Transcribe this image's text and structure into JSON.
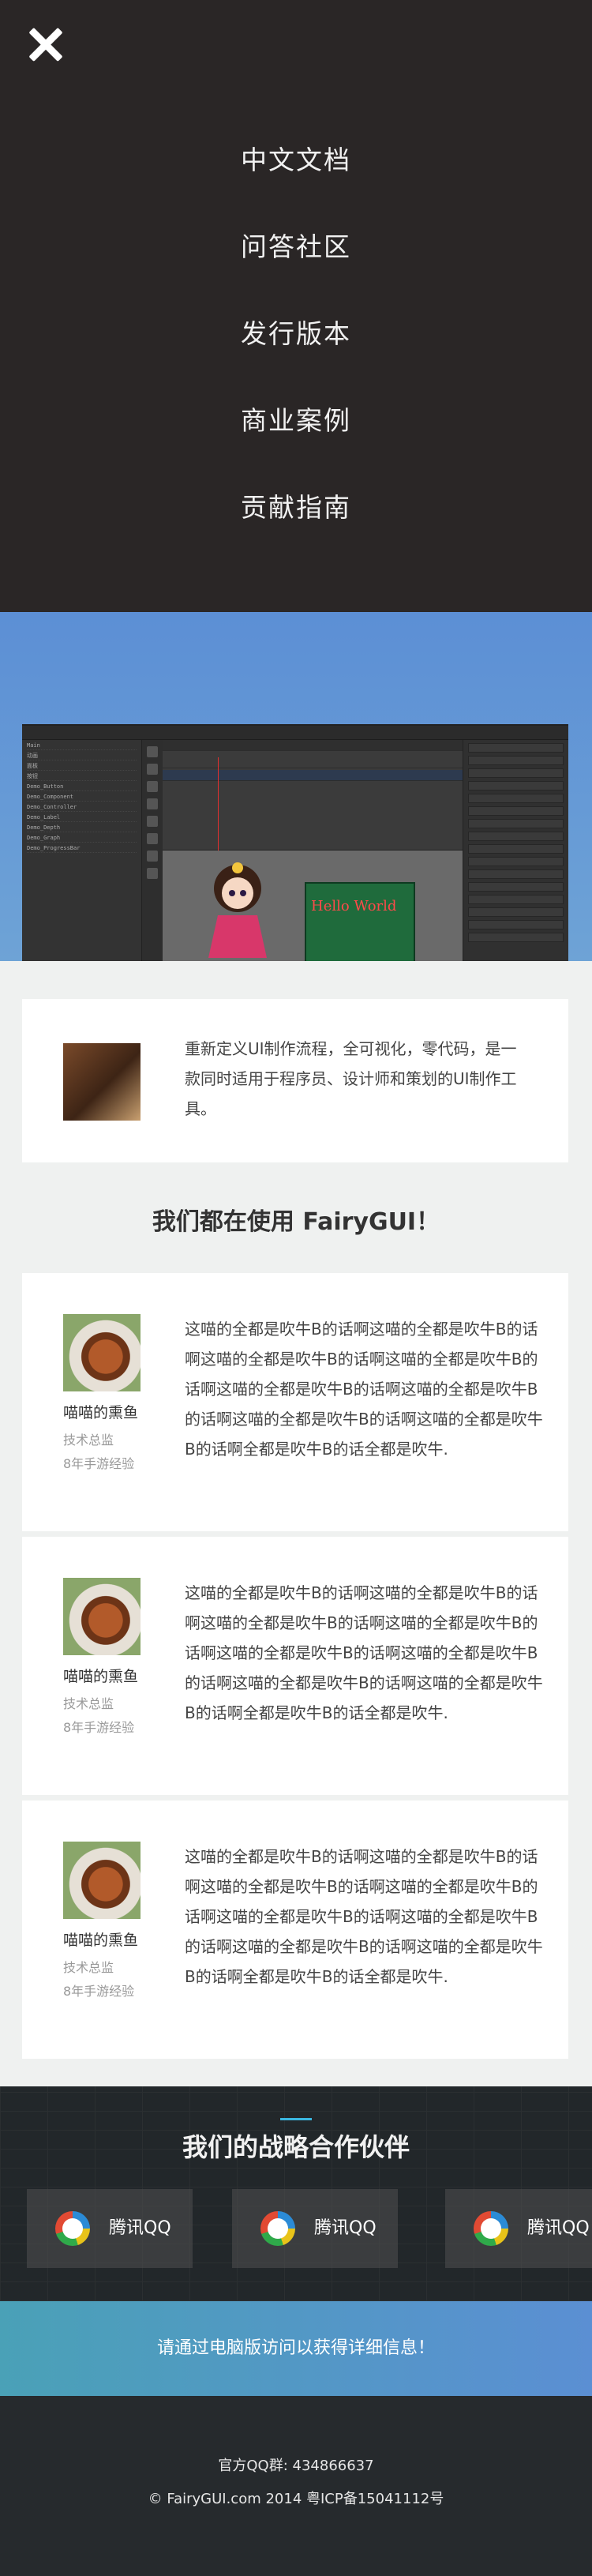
{
  "menu": {
    "items": [
      "中文文档",
      "问答社区",
      "发行版本",
      "商业案例",
      "贡献指南"
    ]
  },
  "editor_preview": {
    "stage_text": "Hello World",
    "tree_items": [
      "Main",
      "动画",
      "面板",
      "按钮",
      "Demo_Button",
      "Demo_Component",
      "Demo_Controller",
      "Demo_Label",
      "Demo_Depth",
      "Demo_Graph",
      "Demo_ProgressBar"
    ]
  },
  "intro": {
    "text": "重新定义UI制作流程，全可视化，零代码，是一款同时适用于程序员、设计师和策划的UI制作工具。"
  },
  "users_section": {
    "title": "我们都在使用 FairyGUI！"
  },
  "testimonials": [
    {
      "name": "喵喵的熏鱼",
      "role": "技术总监",
      "exp": "8年手游经验",
      "text": "这喵的全都是吹牛B的话啊这喵的全都是吹牛B的话啊这喵的全都是吹牛B的话啊这喵的全都是吹牛B的话啊这喵的全都是吹牛B的话啊这喵的全都是吹牛B的话啊这喵的全都是吹牛B的话啊这喵的全都是吹牛B的话啊全都是吹牛B的话全都是吹牛."
    },
    {
      "name": "喵喵的熏鱼",
      "role": "技术总监",
      "exp": "8年手游经验",
      "text": "这喵的全都是吹牛B的话啊这喵的全都是吹牛B的话啊这喵的全都是吹牛B的话啊这喵的全都是吹牛B的话啊这喵的全都是吹牛B的话啊这喵的全都是吹牛B的话啊这喵的全都是吹牛B的话啊这喵的全都是吹牛B的话啊全都是吹牛B的话全都是吹牛."
    },
    {
      "name": "喵喵的熏鱼",
      "role": "技术总监",
      "exp": "8年手游经验",
      "text": "这喵的全都是吹牛B的话啊这喵的全都是吹牛B的话啊这喵的全都是吹牛B的话啊这喵的全都是吹牛B的话啊这喵的全都是吹牛B的话啊这喵的全都是吹牛B的话啊这喵的全都是吹牛B的话啊这喵的全都是吹牛B的话啊全都是吹牛B的话全都是吹牛."
    }
  ],
  "partners": {
    "title": "我们的战略合作伙伴",
    "items": [
      {
        "name": "腾讯QQ",
        "icon": "tencent-qq-icon"
      },
      {
        "name": "腾讯QQ",
        "icon": "tencent-qq-icon"
      },
      {
        "name": "腾讯QQ",
        "icon": "tencent-qq-icon"
      }
    ]
  },
  "banner": {
    "text": "请通过电脑版访问以获得详细信息！"
  },
  "footer": {
    "qq_group": "官方QQ群: 434866637",
    "copyright": "© FairyGUI.com 2014 粤ICP备15041112号"
  },
  "colors": {
    "menu_bg": "#2a2626",
    "hero_gradient": [
      "#5c8fd5",
      "#6ea3d6"
    ],
    "page_bg": "#eff1f0",
    "footer_bg": "#262a2d",
    "banner_gradient": [
      "#4aa1b7",
      "#5b8fd3"
    ],
    "accent": "#3bb7e0"
  }
}
